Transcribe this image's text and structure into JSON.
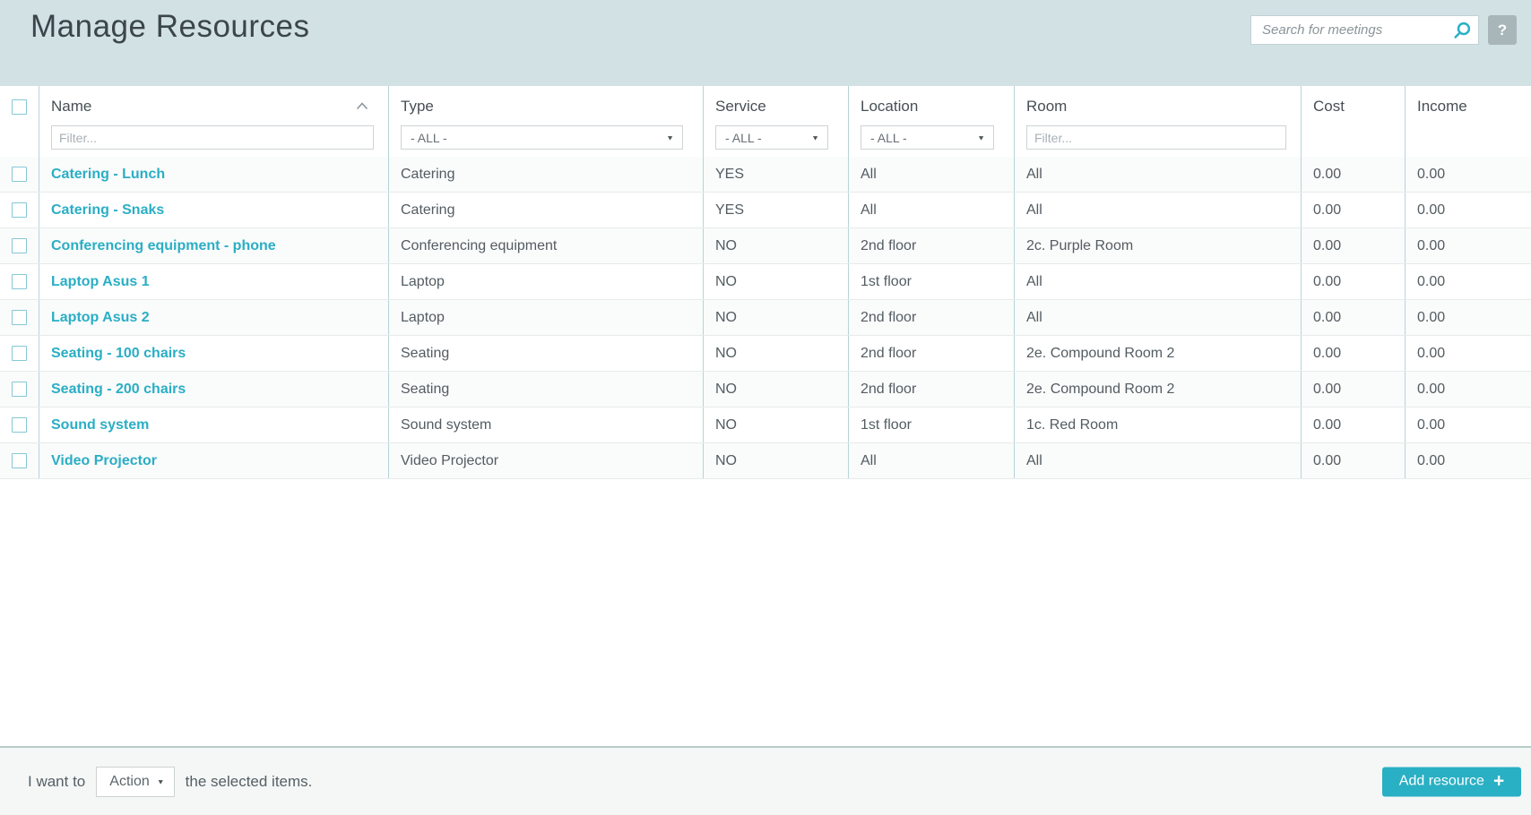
{
  "header": {
    "title": "Manage Resources",
    "search_placeholder": "Search for meetings",
    "help_label": "?"
  },
  "table": {
    "columns": [
      {
        "label": "Name"
      },
      {
        "label": "Type"
      },
      {
        "label": "Service"
      },
      {
        "label": "Location"
      },
      {
        "label": "Room"
      },
      {
        "label": "Cost"
      },
      {
        "label": "Income"
      }
    ],
    "sort": {
      "column": "Name",
      "direction": "ascending"
    },
    "filters": {
      "name_placeholder": "Filter...",
      "type_value": "- ALL -",
      "service_value": "- ALL -",
      "location_value": "- ALL -",
      "room_placeholder": "Filter..."
    },
    "rows": [
      {
        "name": "Catering - Lunch",
        "type": "Catering",
        "service": "YES",
        "location": "All",
        "room": "All",
        "cost": "0.00",
        "income": "0.00"
      },
      {
        "name": "Catering - Snaks",
        "type": "Catering",
        "service": "YES",
        "location": "All",
        "room": "All",
        "cost": "0.00",
        "income": "0.00"
      },
      {
        "name": "Conferencing equipment - phone",
        "type": "Conferencing equipment",
        "service": "NO",
        "location": "2nd floor",
        "room": "2c. Purple Room",
        "cost": "0.00",
        "income": "0.00"
      },
      {
        "name": "Laptop Asus 1",
        "type": "Laptop",
        "service": "NO",
        "location": "1st floor",
        "room": "All",
        "cost": "0.00",
        "income": "0.00"
      },
      {
        "name": "Laptop Asus 2",
        "type": "Laptop",
        "service": "NO",
        "location": "2nd floor",
        "room": "All",
        "cost": "0.00",
        "income": "0.00"
      },
      {
        "name": "Seating - 100 chairs",
        "type": "Seating",
        "service": "NO",
        "location": "2nd floor",
        "room": "2e. Compound Room 2",
        "cost": "0.00",
        "income": "0.00"
      },
      {
        "name": "Seating - 200 chairs",
        "type": "Seating",
        "service": "NO",
        "location": "2nd floor",
        "room": "2e. Compound Room 2",
        "cost": "0.00",
        "income": "0.00"
      },
      {
        "name": "Sound system",
        "type": "Sound system",
        "service": "NO",
        "location": "1st floor",
        "room": "1c. Red Room",
        "cost": "0.00",
        "income": "0.00"
      },
      {
        "name": "Video Projector",
        "type": "Video Projector",
        "service": "NO",
        "location": "All",
        "room": "All",
        "cost": "0.00",
        "income": "0.00"
      }
    ]
  },
  "footer": {
    "prefix": "I want to",
    "action_label": "Action",
    "suffix": "the selected items.",
    "add_button_label": "Add resource"
  },
  "icons": {
    "dropdown_arrow": "▼",
    "plus": "+"
  },
  "colors": {
    "topbar_bg": "#d2e1e4",
    "accent_teal": "#29b0c4",
    "link_teal": "#2aaec5",
    "column_divider": "#b7d4d7"
  }
}
